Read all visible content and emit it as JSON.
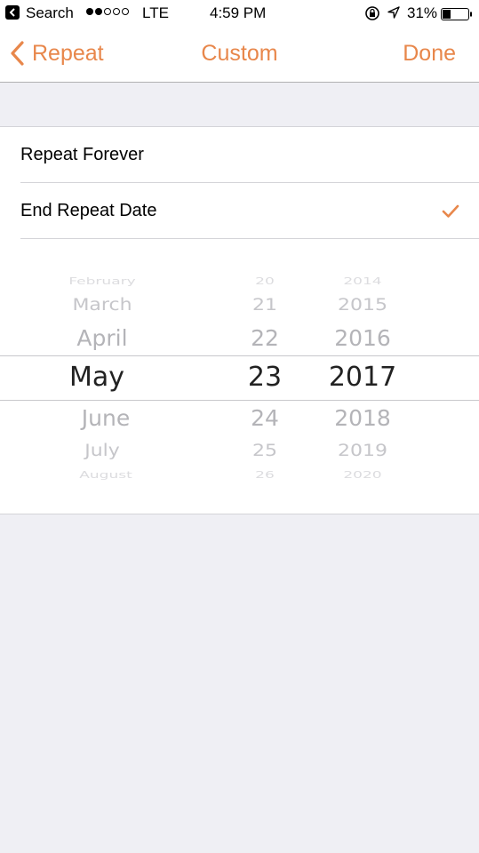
{
  "status_bar": {
    "back_app": "Search",
    "carrier": "LTE",
    "time": "4:59 PM",
    "battery": "31%",
    "signal_bars_filled": 2,
    "signal_bars_total": 5
  },
  "nav": {
    "back_label": "Repeat",
    "title": "Custom",
    "done_label": "Done"
  },
  "options": {
    "repeat_forever": "Repeat Forever",
    "end_repeat_date": "End Repeat Date",
    "selected": "End Repeat Date"
  },
  "picker": {
    "months": [
      "February",
      "March",
      "April",
      "May",
      "June",
      "July",
      "August"
    ],
    "days": [
      "20",
      "21",
      "22",
      "23",
      "24",
      "25",
      "26"
    ],
    "years": [
      "2014",
      "2015",
      "2016",
      "2017",
      "2018",
      "2019",
      "2020"
    ],
    "selected": {
      "month": "May",
      "day": "23",
      "year": "2017"
    }
  },
  "colors": {
    "accent": "#e8874b",
    "background": "#efeff4"
  }
}
